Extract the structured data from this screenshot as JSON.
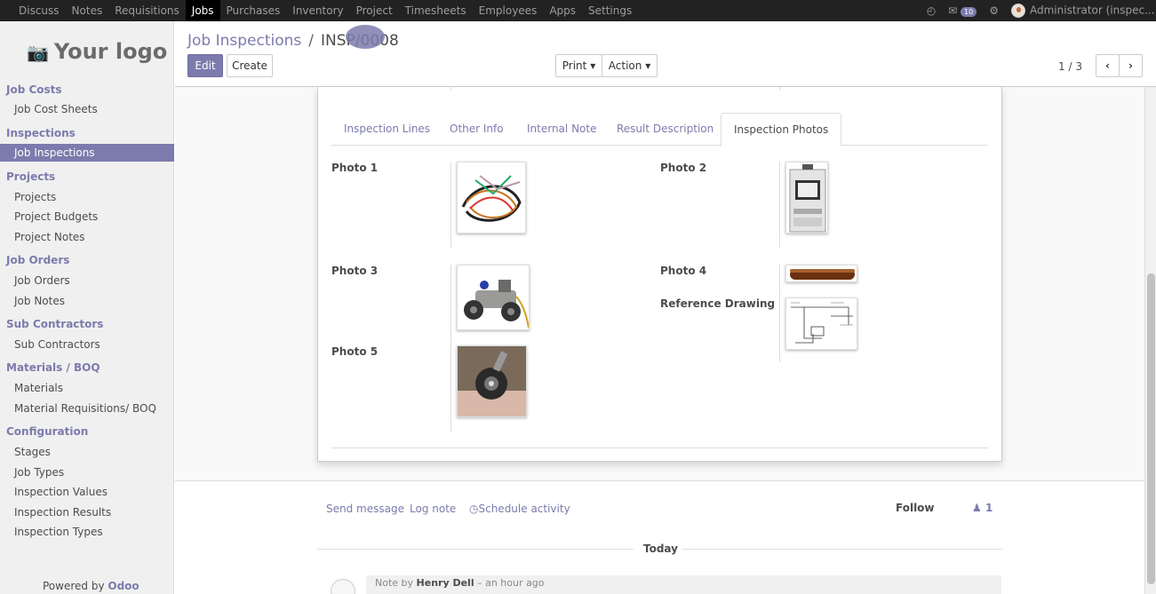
{
  "topbar": {
    "menu": [
      "Discuss",
      "Notes",
      "Requisitions",
      "Jobs",
      "Purchases",
      "Inventory",
      "Project",
      "Timesheets",
      "Employees",
      "Apps",
      "Settings"
    ],
    "active": "Jobs",
    "message_count": "10",
    "user": "Administrator (inspec..."
  },
  "sidebar": {
    "logo": "Your logo",
    "sections": [
      {
        "title": "Job Costs",
        "items": [
          "Job Cost Sheets"
        ]
      },
      {
        "title": "Inspections",
        "items": [
          "Job Inspections"
        ]
      },
      {
        "title": "Projects",
        "items": [
          "Projects",
          "Project Budgets",
          "Project Notes"
        ]
      },
      {
        "title": "Job Orders",
        "items": [
          "Job Orders",
          "Job Notes"
        ]
      },
      {
        "title": "Sub Contractors",
        "items": [
          "Sub Contractors"
        ]
      },
      {
        "title": "Materials / BOQ",
        "items": [
          "Materials",
          "Material Requisitions/ BOQ"
        ]
      },
      {
        "title": "Configuration",
        "items": [
          "Stages",
          "Job Types",
          "Inspection Values",
          "Inspection Results",
          "Inspection Types"
        ]
      }
    ],
    "active_item": "Job Inspections",
    "powered_by": "Powered by",
    "powered_brand": "Odoo"
  },
  "control_panel": {
    "breadcrumb_parent": "Job Inspections",
    "breadcrumb_separator": "/",
    "record_name": "INSP/0008",
    "edit_label": "Edit",
    "create_label": "Create",
    "print_label": "Print",
    "action_label": "Action",
    "pager": "1 / 3"
  },
  "tabs": [
    "Inspection Lines",
    "Other Info",
    "Internal Note",
    "Result Description",
    "Inspection Photos"
  ],
  "active_tab": "Inspection Photos",
  "photos": {
    "photo1": "Photo 1",
    "photo2": "Photo 2",
    "photo3": "Photo 3",
    "photo4": "Photo 4",
    "photo5": "Photo 5",
    "reference": "Reference Drawing"
  },
  "chatter": {
    "send_message": "Send message",
    "log_note": "Log note",
    "schedule_activity": "Schedule activity",
    "follow": "Follow",
    "followers": "1",
    "today": "Today",
    "note_prefix": "Note by",
    "note_author": "Henry Dell",
    "note_time": "– an hour ago"
  }
}
